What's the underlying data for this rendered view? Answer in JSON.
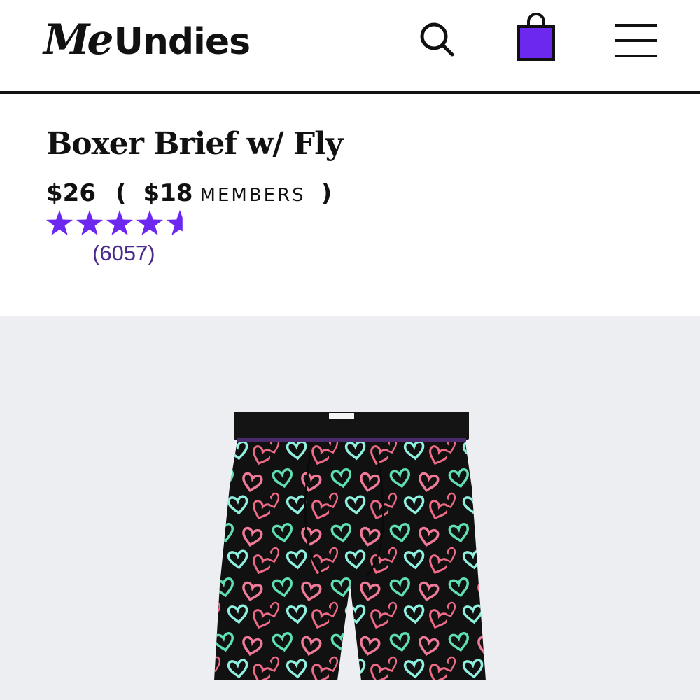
{
  "brand": {
    "logo_me": "Me",
    "logo_undies": "Undies"
  },
  "header": {
    "search_icon": "search-icon",
    "bag_icon": "shopping-bag-icon",
    "menu_icon": "hamburger-menu-icon"
  },
  "colors": {
    "accent": "#6d28f0",
    "text": "#111111",
    "review_count": "#4a2a8c",
    "gallery_bg": "#eceef1"
  },
  "product": {
    "title": "Boxer Brief w/ Fly",
    "price": "$26",
    "open_paren": "(",
    "member_price": "$18",
    "members_label": "MEMBERS",
    "close_paren": ")",
    "rating": 4.6,
    "rating_max": 5,
    "review_count": "(6057)"
  },
  "image": {
    "alt": "Boxer Brief w/ Fly"
  }
}
